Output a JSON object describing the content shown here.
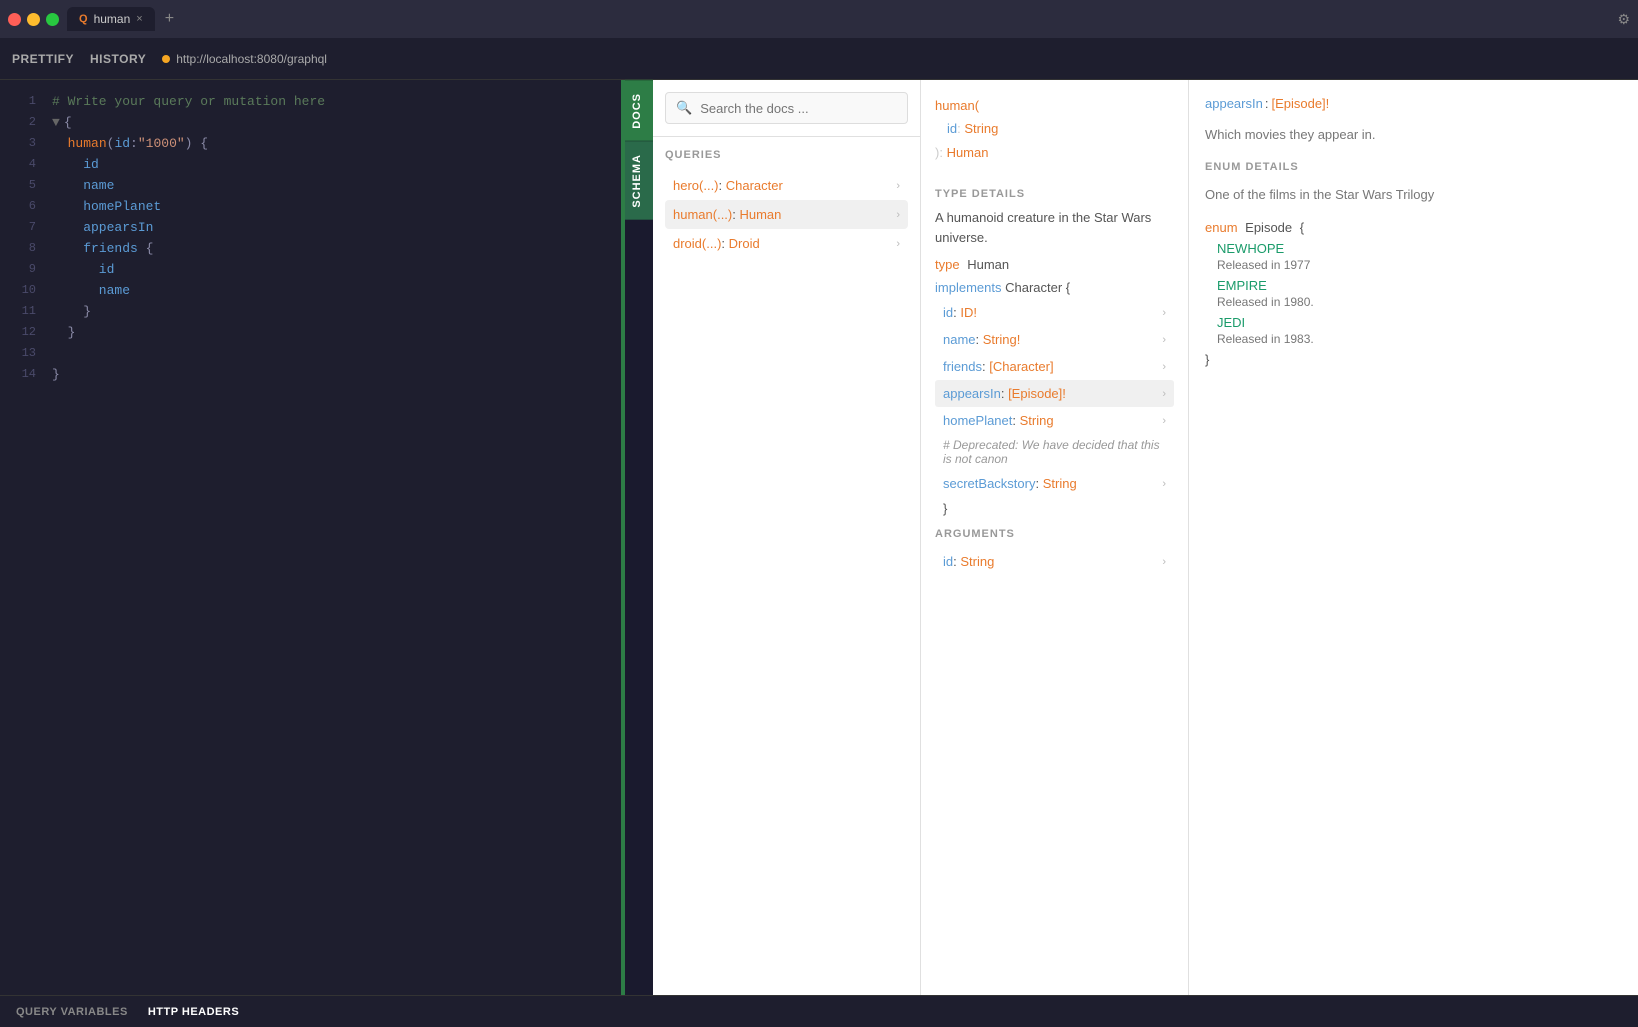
{
  "titleBar": {
    "trafficLights": [
      "red",
      "yellow",
      "green"
    ],
    "tab": {
      "icon": "Q",
      "name": "human",
      "closeLabel": "×"
    },
    "addTabLabel": "+",
    "gearLabel": "⚙"
  },
  "toolbar": {
    "prettifyLabel": "PRETTIFY",
    "historyLabel": "HISTORY",
    "url": "http://localhost:8080/graphql"
  },
  "editor": {
    "lines": [
      {
        "num": "1",
        "content": "# Write your query or mutation here",
        "type": "comment"
      },
      {
        "num": "2",
        "content": "{",
        "type": "brace",
        "collapse": "▼"
      },
      {
        "num": "3",
        "content": "  human(id:\"1000\") {",
        "type": "code"
      },
      {
        "num": "4",
        "content": "    id",
        "type": "code"
      },
      {
        "num": "5",
        "content": "    name",
        "type": "code"
      },
      {
        "num": "6",
        "content": "    homePlanet",
        "type": "code"
      },
      {
        "num": "7",
        "content": "    appearsIn",
        "type": "code"
      },
      {
        "num": "8",
        "content": "    friends {",
        "type": "code"
      },
      {
        "num": "9",
        "content": "      id",
        "type": "code"
      },
      {
        "num": "10",
        "content": "      name",
        "type": "code"
      },
      {
        "num": "11",
        "content": "    }",
        "type": "code"
      },
      {
        "num": "12",
        "content": "  }",
        "type": "code"
      },
      {
        "num": "13",
        "content": "",
        "type": "empty"
      },
      {
        "num": "14",
        "content": "}",
        "type": "brace"
      }
    ]
  },
  "sideTabs": {
    "docs": "DOCS",
    "schema": "SCHEMA"
  },
  "docsPanel": {
    "searchPlaceholder": "Search the docs ...",
    "queriesLabel": "QUERIES",
    "queries": [
      {
        "name": "hero(...)",
        "type": "Character"
      },
      {
        "name": "human(...)",
        "type": "Human",
        "active": true
      },
      {
        "name": "droid(...)",
        "type": "Droid"
      }
    ]
  },
  "typePanel": {
    "signature": {
      "name": "human(",
      "idField": "id",
      "idType": "String",
      "closeParen": "):",
      "returnType": "Human"
    },
    "typeDetailsLabel": "TYPE DETAILS",
    "typeDescription": "A humanoid creature in the Star Wars universe.",
    "typeKeyword": "type",
    "typeName": "Human",
    "implementsKeyword": "implements",
    "implementsType": "Character",
    "implementsBrace": "{",
    "fields": [
      {
        "name": "id",
        "type": "ID!",
        "active": false
      },
      {
        "name": "name",
        "type": "String!",
        "active": false
      },
      {
        "name": "friends",
        "type": "[Character]",
        "active": false
      },
      {
        "name": "appearsIn",
        "type": "[Episode]!",
        "active": true
      },
      {
        "name": "homePlanet",
        "type": "String",
        "active": false
      }
    ],
    "deprecatedComment": "# Deprecated: We have decided that this is not canon",
    "secretBackstoryField": "secretBackstory",
    "secretBackstoryType": "String",
    "closingBrace": "}",
    "argumentsLabel": "ARGUMENTS",
    "argIdField": "id",
    "argIdType": "String"
  },
  "rightPanel": {
    "fieldName": "appearsIn",
    "fieldColon": ":",
    "fieldType": "[Episode]!",
    "fieldDescription": "Which movies they appear in.",
    "enumDetailsLabel": "ENUM DETAILS",
    "enumDescription": "One of the films in the Star Wars Trilogy",
    "enumKeyword": "enum",
    "enumName": "Episode",
    "enumBrace": "{",
    "enumValues": [
      {
        "value": "NEWHOPE",
        "description": "Released in 1977"
      },
      {
        "value": "EMPIRE",
        "description": "Released in 1980."
      },
      {
        "value": "JEDI",
        "description": "Released in 1983."
      }
    ],
    "enumClose": "}"
  },
  "bottomBar": {
    "queryVarsLabel": "QUERY VARIABLES",
    "httpHeadersLabel": "HTTP HEADERS"
  }
}
